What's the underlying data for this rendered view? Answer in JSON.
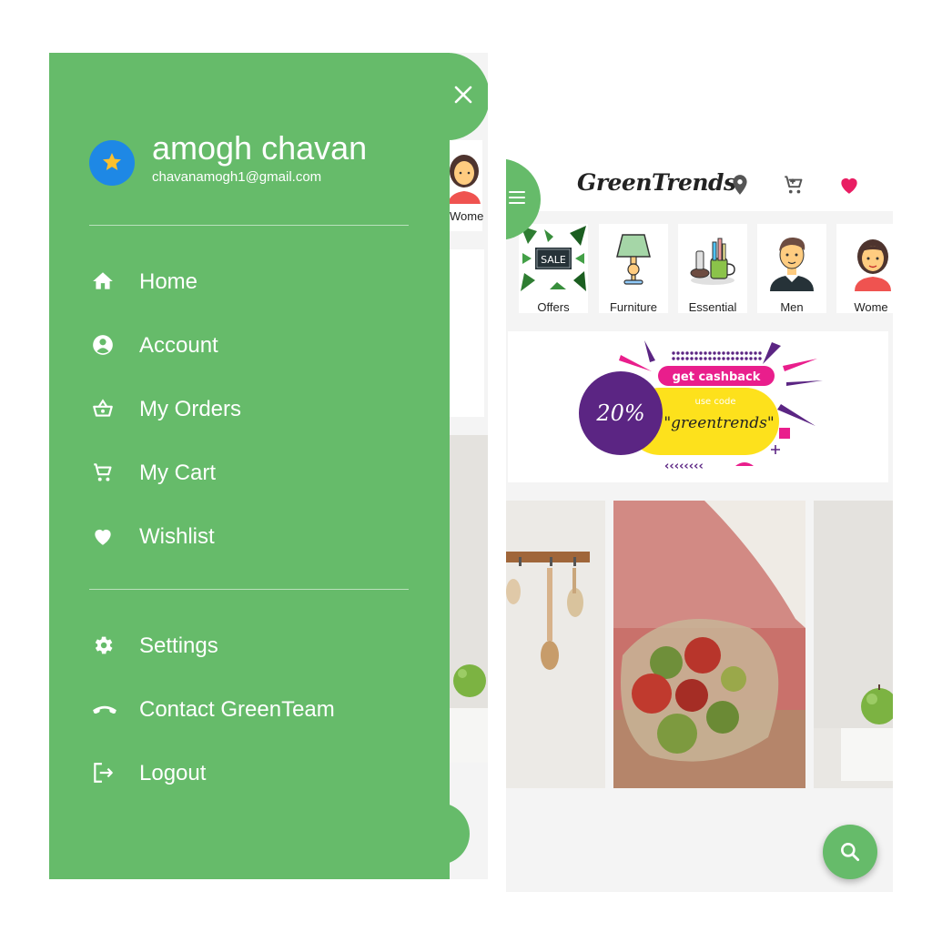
{
  "drawer": {
    "user_name": "amogh chavan",
    "user_email": "chavanamogh1@gmail.com",
    "nav_items": [
      {
        "label": "Home",
        "icon": "home-icon"
      },
      {
        "label": "Account",
        "icon": "account-circle-icon"
      },
      {
        "label": "My Orders",
        "icon": "basket-icon"
      },
      {
        "label": "My Cart",
        "icon": "cart-icon"
      },
      {
        "label": "Wishlist",
        "icon": "heart-icon"
      }
    ],
    "secondary_items": [
      {
        "label": "Settings",
        "icon": "gear-icon"
      },
      {
        "label": "Contact GreenTeam",
        "icon": "phone-icon"
      },
      {
        "label": "Logout",
        "icon": "logout-icon"
      }
    ],
    "background_peek_label": "Wome"
  },
  "app": {
    "logo": "GreenTrends",
    "categories": [
      "Offers",
      "Furniture",
      "Essential",
      "Men",
      "Wome"
    ],
    "sale_tag": "SALE",
    "banner": {
      "headline": "get cashback",
      "percent": "20%",
      "use_code": "use code",
      "code": "\"greentrends\""
    }
  },
  "colors": {
    "primary_green": "#66bb6a",
    "heart_pink": "#e91e63",
    "avatar_blue": "#1e88e5",
    "star_yellow": "#fbc02d",
    "banner_purple": "#5b2583",
    "banner_yellow": "#fde11c",
    "banner_pink": "#e91e8c"
  }
}
